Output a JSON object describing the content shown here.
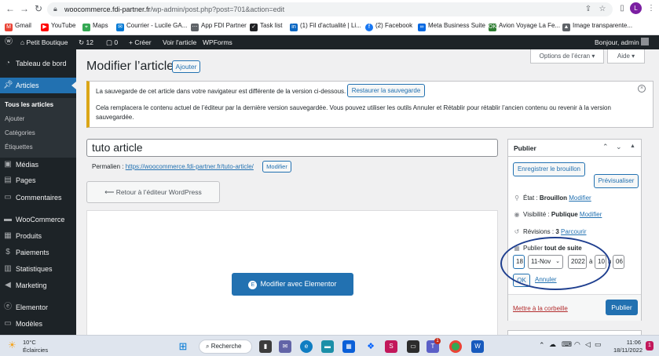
{
  "browser": {
    "url_domain": "woocommerce.fdi-partner.fr",
    "url_path": "/wp-admin/post.php?post=701&action=edit",
    "profile_initial": "L",
    "bookmarks": [
      "Gmail",
      "YouTube",
      "Maps",
      "Courrier - Lucile GA...",
      "App FDI Partner",
      "Task list",
      "(1) Fil d'actualité | Li...",
      "(2) Facebook",
      "Meta Business Suite",
      "Avion Voyage La Fe...",
      "Image transparente..."
    ]
  },
  "adminbar": {
    "site_name": "Petit Boutique",
    "updates_count": "12",
    "comments_count": "0",
    "new_label": "Créer",
    "view_label": "Voir l'article",
    "wpforms_label": "WPForms",
    "greeting": "Bonjour, admin"
  },
  "sidebar": {
    "items": {
      "dashboard": "Tableau de bord",
      "articles": "Articles",
      "medias": "Médias",
      "pages": "Pages",
      "comments": "Commentaires",
      "woocommerce": "WooCommerce",
      "products": "Produits",
      "payments": "Paiements",
      "stats": "Statistiques",
      "marketing": "Marketing",
      "elementor": "Elementor",
      "models": "Modèles"
    },
    "submenu": [
      "Tous les articles",
      "Ajouter",
      "Catégories",
      "Étiquettes"
    ]
  },
  "page": {
    "title": "Modifier l’article",
    "add_button": "Ajouter",
    "screen_options": "Options de l’écran ▾",
    "help": "Aide ▾"
  },
  "notice": {
    "line1": "La sauvegarde de cet article dans votre navigateur est différente de la version ci-dessous.",
    "restore_button": "Restaurer la sauvegarde",
    "line2": "Cela remplacera le contenu actuel de l’éditeur par la dernière version sauvegardée. Vous pouvez utiliser les outils Annuler et Rétablir pour rétablir l’ancien contenu ou revenir à la version sauvegardée."
  },
  "editor": {
    "post_title": "tuto article",
    "permalink_label": "Permalien :",
    "permalink_url": "https://woocommerce.fdi-partner.fr/tuto-article/",
    "permalink_edit": "Modifier",
    "back_button": "Retour à l’éditeur WordPress",
    "elementor_button": "Modifier avec Elementor"
  },
  "publish": {
    "heading": "Publier",
    "save_draft": "Enregistrer le brouillon",
    "preview": "Prévisualiser",
    "status_label": "État :",
    "status_value": "Brouillon",
    "visibility_label": "Visibilité :",
    "visibility_value": "Publique",
    "revisions_label": "Révisions :",
    "revisions_value": "3",
    "browse": "Parcourir",
    "modify": "Modifier",
    "publish_label": "Publier",
    "publish_when": "tout de suite",
    "day": "18",
    "month": "11-Nov",
    "year": "2022",
    "at": "à",
    "hour": "10",
    "h": "h",
    "minute": "06",
    "ok": "OK",
    "cancel": "Annuler",
    "trash": "Mettre à la corbeille",
    "publish_button": "Publier"
  },
  "taskbar": {
    "temperature": "10°C",
    "weather": "Éclaircies",
    "search": "Recherche",
    "time": "11:06",
    "date": "18/11/2022",
    "teams_badge": "1"
  },
  "colors": {
    "accent": "#2271b1",
    "adminbar": "#1d2327",
    "notice_border": "#dba617",
    "elementor": "#2271b1"
  }
}
